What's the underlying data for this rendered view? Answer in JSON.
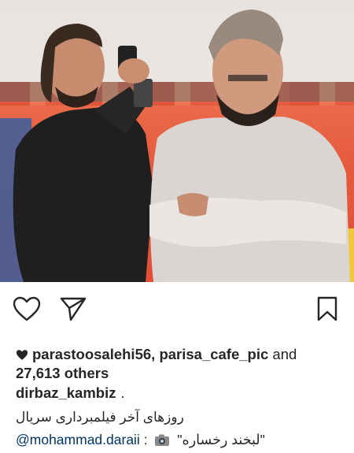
{
  "post": {
    "likers": [
      "parastoosalehi56",
      "parisa_cafe_pic"
    ],
    "likes_and": "and",
    "likes_others": "27,613 others",
    "author": "dirbaz_kambiz",
    "author_suffix": ".",
    "caption_line1": "روزهای آخر فیلمبرداری سریال",
    "caption_mention": "@mohammad.daraii",
    "caption_sep": ":",
    "caption_quote": "\"لبخند رخساره\""
  },
  "icons": {
    "like": "heart-outline-icon",
    "share": "paper-plane-icon",
    "save": "bookmark-icon",
    "liked_heart": "heart-filled-icon",
    "camera": "camera-emoji-icon"
  },
  "colors": {
    "text": "#262626",
    "mention": "#003569",
    "photo_wall": "#e55a3d",
    "photo_stripe": "#2f7f86"
  }
}
